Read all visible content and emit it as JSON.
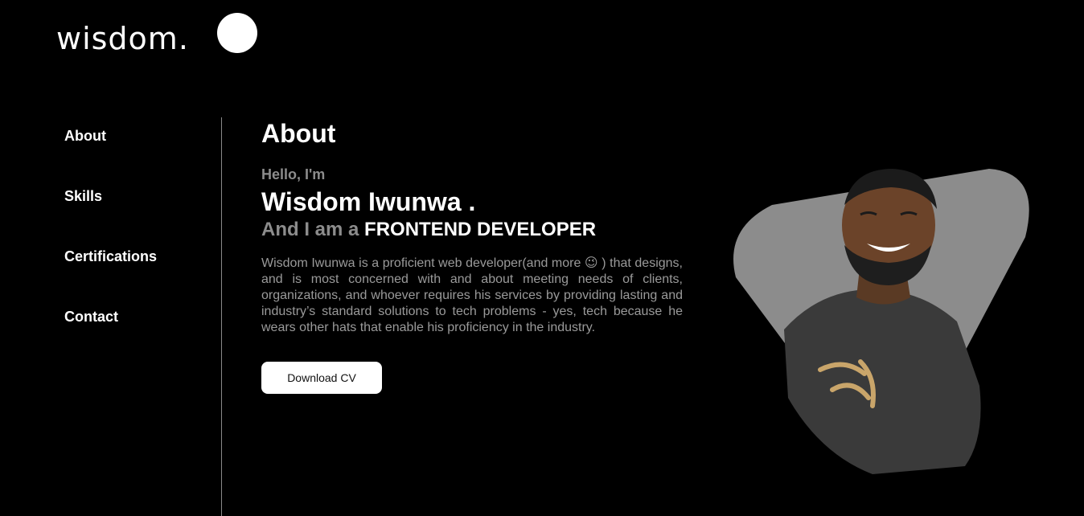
{
  "header": {
    "logo_text": "wisdom.",
    "theme_toggle_icon": "circle-toggle-icon"
  },
  "sidebar": {
    "items": [
      {
        "label": "About"
      },
      {
        "label": "Skills"
      },
      {
        "label": "Certifications"
      },
      {
        "label": "Contact"
      }
    ]
  },
  "main": {
    "title": "About",
    "greeting": "Hello, I'm",
    "name": "Wisdom Iwunwa .",
    "role_prefix": "And I am a ",
    "role_title": "FRONTEND DEVELOPER",
    "bio": "Wisdom Iwunwa is a proficient web developer(and more 😉 ) that designs, and is most concerned with and about meeting needs of clients, organizations, and whoever requires his services by providing lasting and industry’s standard solutions to tech problems - yes, tech because he wears other hats that enable his proficiency in the industry.",
    "cv_button": "Download CV"
  },
  "portrait": {
    "icon": "profile-photo-icon",
    "shape_color": "#8c8c8c"
  },
  "colors": {
    "background": "#000000",
    "text": "#ffffff",
    "muted": "#8c8c8c",
    "button_bg": "#ffffff"
  }
}
